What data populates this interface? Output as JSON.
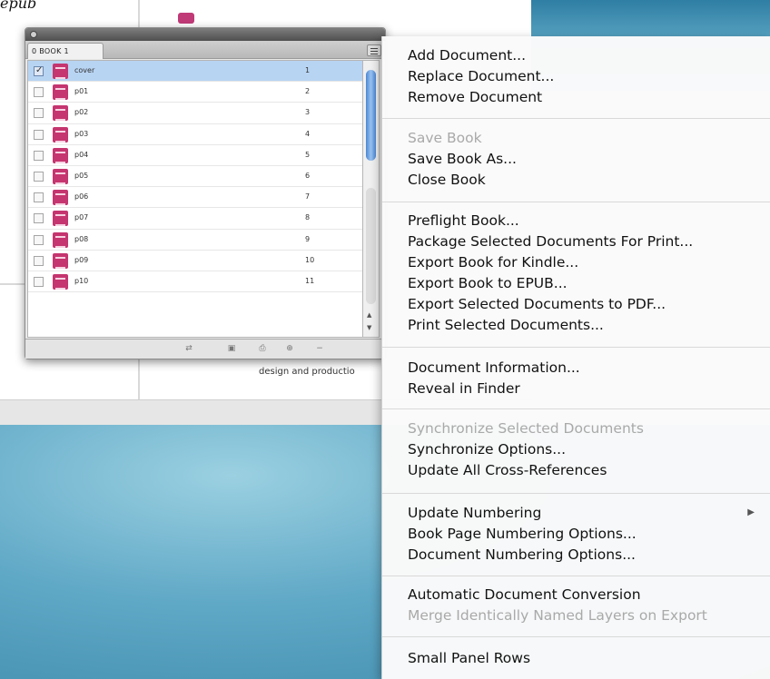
{
  "background": {
    "caption_top": "epub",
    "doc_caption": "design and productio"
  },
  "book_panel": {
    "tab_label": "0 BOOK 1",
    "documents": [
      {
        "name": "cover",
        "page": "1",
        "selected": true,
        "checked": true
      },
      {
        "name": "p01",
        "page": "2"
      },
      {
        "name": "p02",
        "page": "3"
      },
      {
        "name": "p03",
        "page": "4"
      },
      {
        "name": "p04",
        "page": "5"
      },
      {
        "name": "p05",
        "page": "6"
      },
      {
        "name": "p06",
        "page": "7"
      },
      {
        "name": "p07",
        "page": "8"
      },
      {
        "name": "p08",
        "page": "9"
      },
      {
        "name": "p09",
        "page": "10"
      },
      {
        "name": "p10",
        "page": "11"
      }
    ],
    "footer_icons": [
      "synchronize-icon",
      "save-book-icon",
      "print-book-icon",
      "add-document-icon",
      "remove-document-icon"
    ],
    "scroll_up_glyph": "▲",
    "scroll_down_glyph": "▼"
  },
  "menu": {
    "add_document": "Add Document...",
    "replace_document": "Replace Document...",
    "remove_document": "Remove Document",
    "save_book": "Save Book",
    "save_book_as": "Save Book As...",
    "close_book": "Close Book",
    "preflight_book": "Preflight Book...",
    "package_for_print": "Package Selected Documents For Print...",
    "export_kindle": "Export Book for Kindle...",
    "export_epub": "Export Book to EPUB...",
    "export_pdf": "Export Selected Documents to PDF...",
    "print_selected": "Print Selected Documents...",
    "document_information": "Document Information...",
    "reveal_in_finder": "Reveal in Finder",
    "synchronize_selected": "Synchronize Selected Documents",
    "synchronize_options": "Synchronize Options...",
    "update_cross_references": "Update All Cross-References",
    "update_numbering": "Update Numbering",
    "submenu_arrow": "▶",
    "book_page_numbering": "Book Page Numbering Options...",
    "document_numbering": "Document Numbering Options...",
    "automatic_conversion": "Automatic Document Conversion",
    "merge_layers": "Merge Identically Named Layers on Export",
    "small_panel_rows": "Small Panel Rows"
  },
  "colors": {
    "selection": "#b8d4f3",
    "indesign_doc_icon": "#c5356f",
    "disabled_text": "#a9a9a9"
  }
}
